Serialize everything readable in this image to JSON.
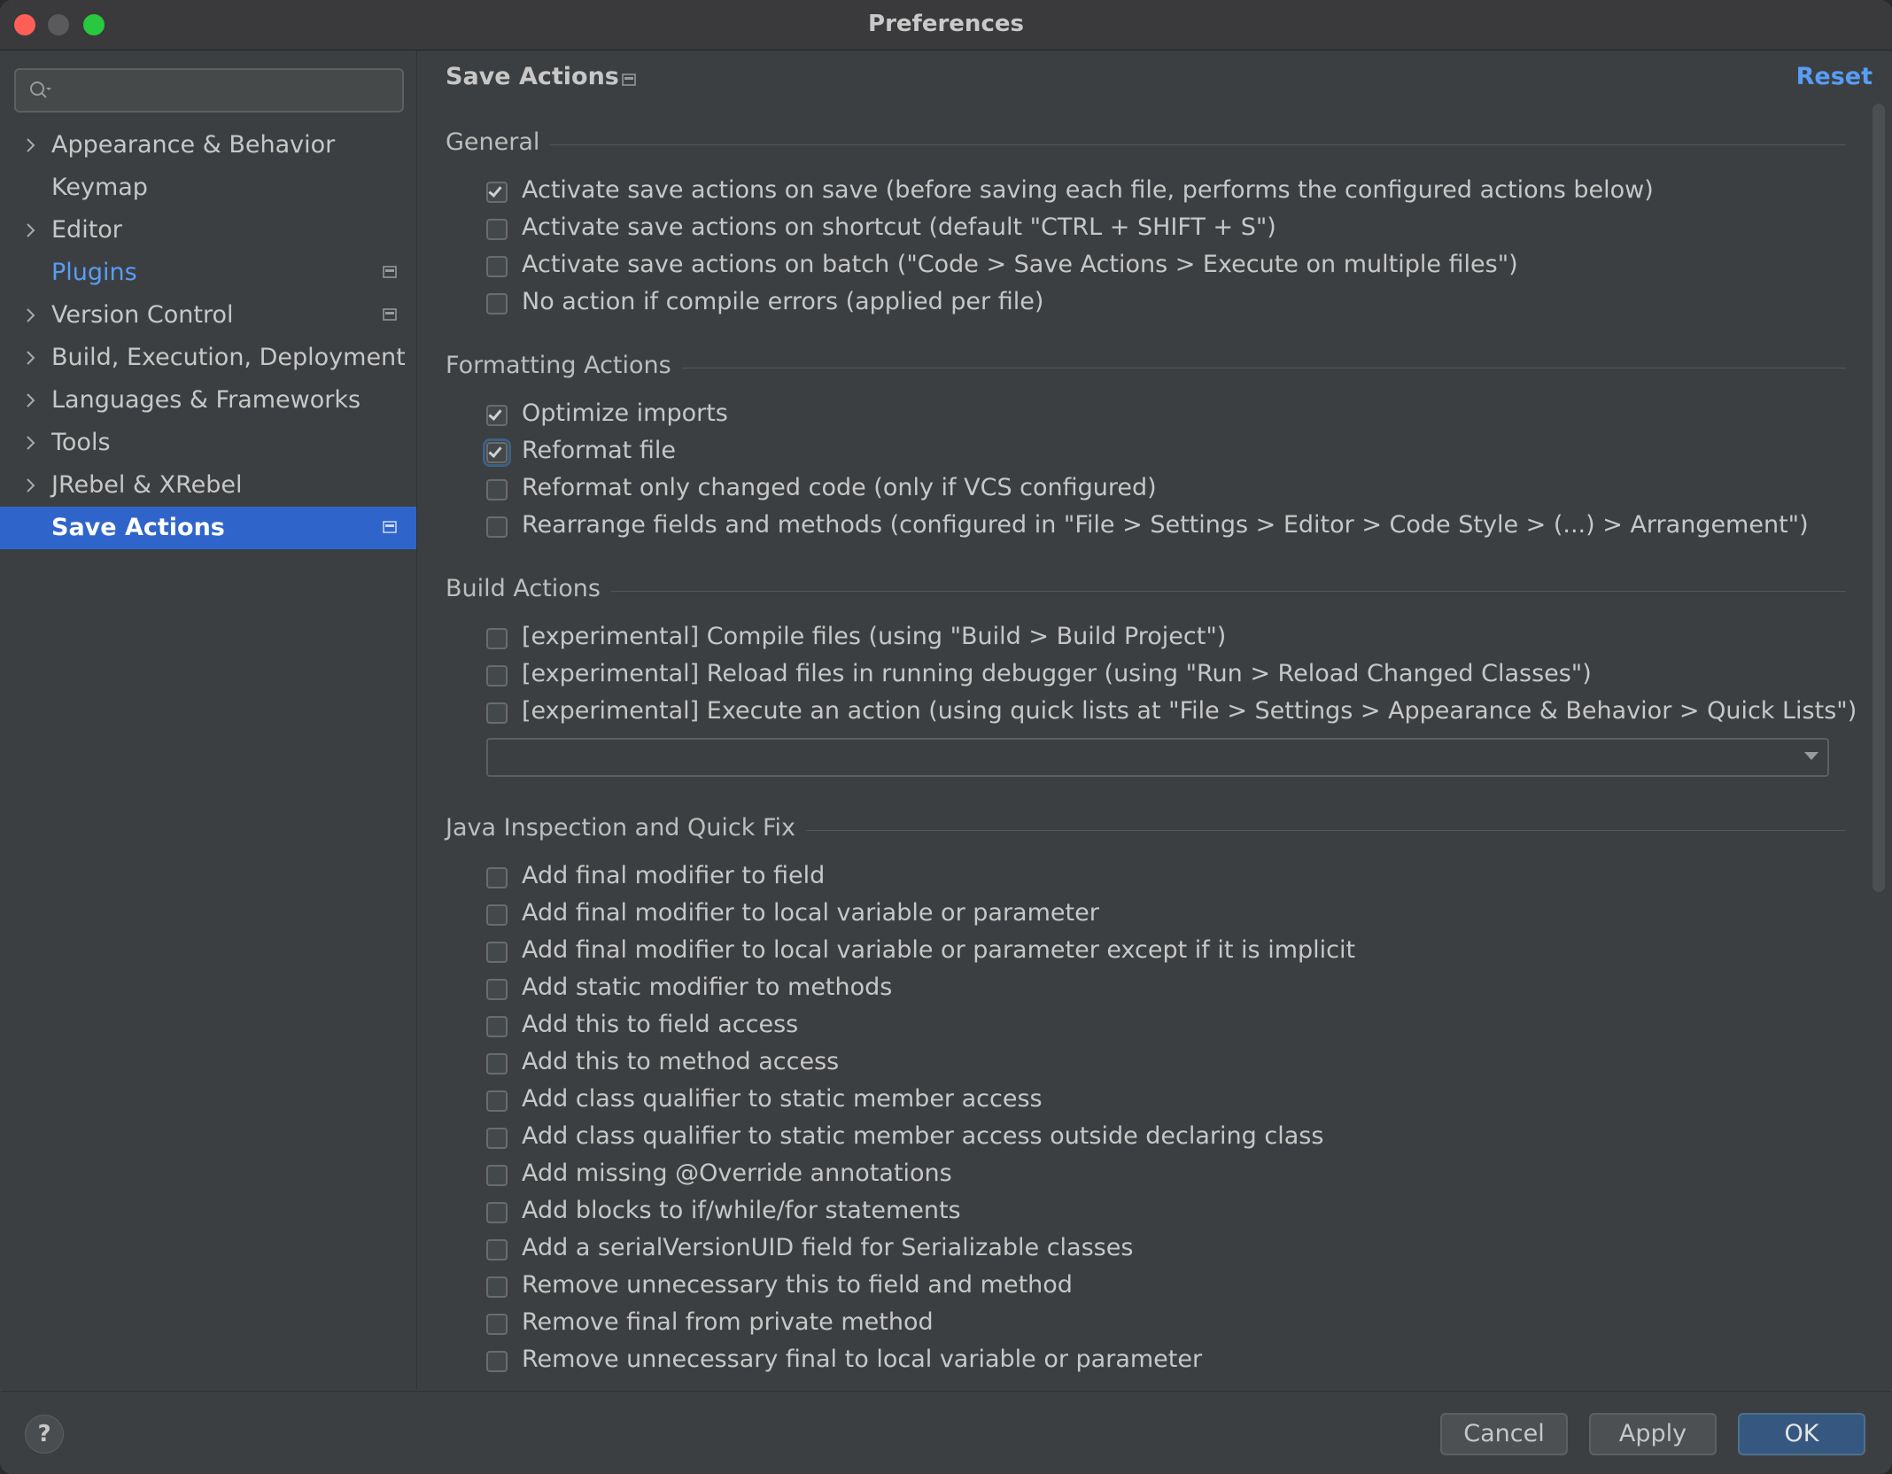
{
  "window": {
    "title": "Preferences"
  },
  "search": {
    "placeholder": ""
  },
  "sidebar": {
    "items": [
      {
        "label": "Appearance & Behavior",
        "expandable": true
      },
      {
        "label": "Keymap",
        "expandable": false
      },
      {
        "label": "Editor",
        "expandable": true
      },
      {
        "label": "Plugins",
        "expandable": false,
        "link": true,
        "badge": true
      },
      {
        "label": "Version Control",
        "expandable": true,
        "badge": true
      },
      {
        "label": "Build, Execution, Deployment",
        "expandable": true
      },
      {
        "label": "Languages & Frameworks",
        "expandable": true
      },
      {
        "label": "Tools",
        "expandable": true
      },
      {
        "label": "JRebel & XRebel",
        "expandable": true
      },
      {
        "label": "Save Actions",
        "expandable": false,
        "selected": true,
        "badge": true
      }
    ]
  },
  "main": {
    "title": "Save Actions",
    "reset_label": "Reset",
    "sections": {
      "general": {
        "title": "General",
        "options": [
          {
            "label": "Activate save actions on save (before saving each file, performs the configured actions below)",
            "checked": true
          },
          {
            "label": "Activate save actions on shortcut (default \"CTRL + SHIFT + S\")",
            "checked": false
          },
          {
            "label": "Activate save actions on batch (\"Code > Save Actions > Execute on multiple files\")",
            "checked": false
          },
          {
            "label": "No action if compile errors (applied per file)",
            "checked": false
          }
        ]
      },
      "formatting": {
        "title": "Formatting Actions",
        "options": [
          {
            "label": "Optimize imports",
            "checked": true
          },
          {
            "label": "Reformat file",
            "checked": true
          },
          {
            "label": "Reformat only changed code (only if VCS configured)",
            "checked": false
          },
          {
            "label": "Rearrange fields and methods (configured in \"File > Settings > Editor > Code Style > (...) > Arrangement\")",
            "checked": false
          }
        ]
      },
      "build": {
        "title": "Build Actions",
        "options": [
          {
            "label": "[experimental] Compile files (using \"Build > Build Project\")",
            "checked": false
          },
          {
            "label": "[experimental] Reload files in running debugger (using \"Run > Reload Changed Classes\")",
            "checked": false
          },
          {
            "label": "[experimental] Execute an action (using quick lists at \"File > Settings > Appearance & Behavior > Quick Lists\")",
            "checked": false
          }
        ],
        "quick_list_value": ""
      },
      "java": {
        "title": "Java Inspection and Quick Fix",
        "options": [
          {
            "label": "Add final modifier to field",
            "checked": false
          },
          {
            "label": "Add final modifier to local variable or parameter",
            "checked": false
          },
          {
            "label": "Add final modifier to local variable or parameter except if it is implicit",
            "checked": false
          },
          {
            "label": "Add static modifier to methods",
            "checked": false
          },
          {
            "label": "Add this to field access",
            "checked": false
          },
          {
            "label": "Add this to method access",
            "checked": false
          },
          {
            "label": "Add class qualifier to static member access",
            "checked": false
          },
          {
            "label": "Add class qualifier to static member access outside declaring class",
            "checked": false
          },
          {
            "label": "Add missing @Override annotations",
            "checked": false
          },
          {
            "label": "Add blocks to if/while/for statements",
            "checked": false
          },
          {
            "label": "Add a serialVersionUID field for Serializable classes",
            "checked": false
          },
          {
            "label": "Remove unnecessary this to field and method",
            "checked": false
          },
          {
            "label": "Remove final from private method",
            "checked": false
          },
          {
            "label": "Remove unnecessary final to local variable or parameter",
            "checked": false
          }
        ]
      }
    }
  },
  "footer": {
    "help_label": "?",
    "cancel_label": "Cancel",
    "apply_label": "Apply",
    "ok_label": "OK"
  },
  "colors": {
    "accent": "#2f65ca",
    "link": "#589df6",
    "background": "#3c3f41",
    "primary_button": "#365880"
  }
}
